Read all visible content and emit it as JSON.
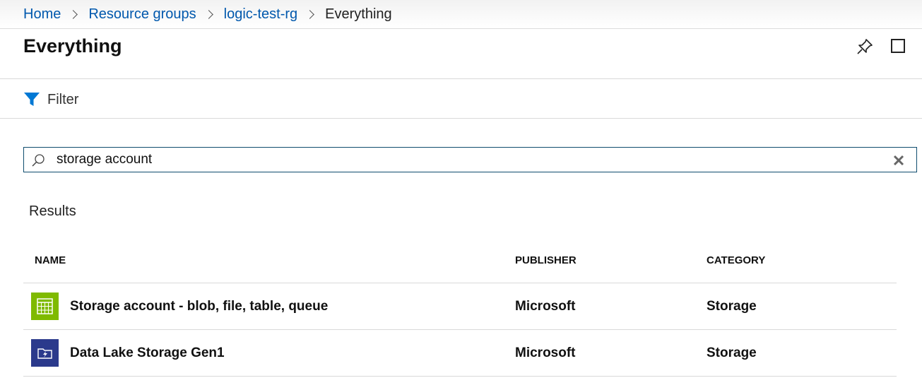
{
  "breadcrumb": {
    "items": [
      {
        "label": "Home"
      },
      {
        "label": "Resource groups"
      },
      {
        "label": "logic-test-rg"
      }
    ],
    "current": "Everything"
  },
  "page": {
    "title": "Everything"
  },
  "toolbar": {
    "filter_label": "Filter",
    "pin_icon": "pin-icon",
    "maximize_icon": "maximize-icon"
  },
  "search": {
    "value": "storage account",
    "icon": "search-icon",
    "clear_icon": "close-icon"
  },
  "results": {
    "heading": "Results",
    "columns": {
      "name": "NAME",
      "publisher": "PUBLISHER",
      "category": "CATEGORY"
    },
    "rows": [
      {
        "icon": "storage-account-icon",
        "icon_color": "#7fba00",
        "name": "Storage account - blob, file, table, queue",
        "publisher": "Microsoft",
        "category": "Storage"
      },
      {
        "icon": "data-lake-storage-icon",
        "icon_color": "#2b3a8c",
        "name": "Data Lake Storage Gen1",
        "publisher": "Microsoft",
        "category": "Storage"
      }
    ]
  },
  "colors": {
    "link": "#0058ad",
    "filter_icon": "#0078d4",
    "search_border": "#0e4c6e"
  }
}
